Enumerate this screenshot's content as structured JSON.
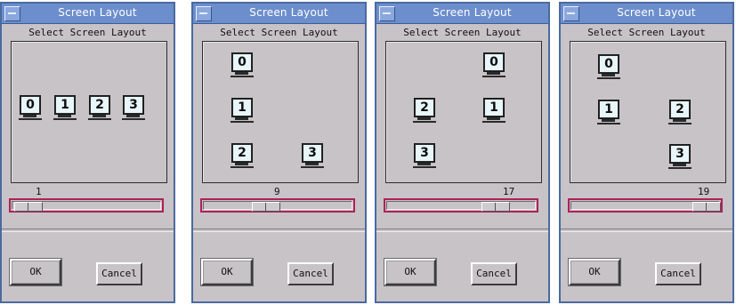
{
  "panels": [
    {
      "title": "Screen Layout",
      "heading": "Select Screen Layout",
      "slider_value": "1",
      "monitors": [
        "0",
        "1",
        "2",
        "3"
      ],
      "ok": "OK",
      "cancel": "Cancel"
    },
    {
      "title": "Screen Layout",
      "heading": "Select Screen Layout",
      "slider_value": "9",
      "monitors": [
        "0",
        "1",
        "2",
        "3"
      ],
      "ok": "OK",
      "cancel": "Cancel"
    },
    {
      "title": "Screen Layout",
      "heading": "Select Screen Layout",
      "slider_value": "17",
      "monitors": [
        "0",
        "1",
        "2",
        "3"
      ],
      "ok": "OK",
      "cancel": "Cancel"
    },
    {
      "title": "Screen Layout",
      "heading": "Select Screen Layout",
      "slider_value": "19",
      "monitors": [
        "0",
        "1",
        "2",
        "3"
      ],
      "ok": "OK",
      "cancel": "Cancel"
    }
  ],
  "colors": {
    "window_bg": "#c7c3c7",
    "titlebar": "#6c8ecc",
    "slider_border": "#b0205a",
    "monitor_screen": "#bfe6f2"
  },
  "icons": {
    "system_menu": "window-menu-icon",
    "monitor": "monitor-icon"
  }
}
